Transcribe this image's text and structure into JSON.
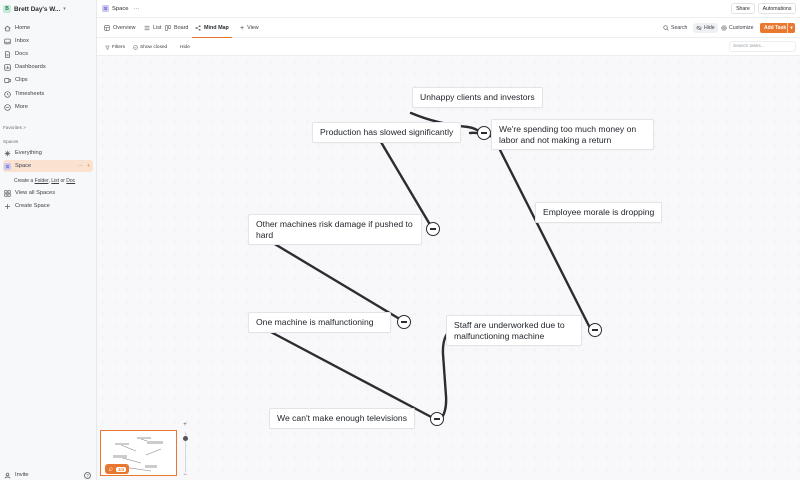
{
  "workspace": {
    "initial": "B",
    "name": "Brett Day's W...",
    "chevron_icon": "chevron-down-icon"
  },
  "sidebar": {
    "nav": [
      {
        "label": "Home",
        "icon": "home-icon"
      },
      {
        "label": "Inbox",
        "icon": "inbox-icon"
      },
      {
        "label": "Docs",
        "icon": "docs-icon"
      },
      {
        "label": "Dashboards",
        "icon": "dashboard-icon"
      },
      {
        "label": "Clips",
        "icon": "clips-icon"
      },
      {
        "label": "Timesheets",
        "icon": "timesheet-icon"
      },
      {
        "label": "More",
        "icon": "more-icon"
      }
    ],
    "favorites_label": "Favorites",
    "favorites_chevron": ">",
    "spaces_label": "Spaces",
    "everything_label": "Everything",
    "space": {
      "initial": "S",
      "label": "Space",
      "dots": "···",
      "plus": "+"
    },
    "create_prefix": "Create a",
    "create_folder": "Folder",
    "create_list": "List",
    "create_or": "or",
    "create_doc": "Doc",
    "view_all_spaces": "View all Spaces",
    "create_space": "Create Space",
    "invite_label": "Invite",
    "help": "?"
  },
  "topbar": {
    "space_initial": "S",
    "space_title": "Space",
    "dots": "···",
    "share_label": "Share",
    "automations_label": "Automations"
  },
  "views": {
    "tabs": [
      {
        "label": "Overview",
        "icon": "overview-icon"
      },
      {
        "label": "List",
        "icon": "list-icon"
      },
      {
        "label": "Board",
        "icon": "board-icon"
      },
      {
        "label": "Mind Map",
        "icon": "mindmap-icon",
        "active": true
      }
    ],
    "add_view_label": "View",
    "search_label": "Search",
    "hide_label": "Hide",
    "customize_label": "Customize",
    "add_task_label": "Add Task",
    "add_task_caret": "▾"
  },
  "filters": {
    "filters_label": "Filters",
    "show_closed_label": "Show closed",
    "hide_label": "Hide",
    "search_placeholder": "Search tasks..."
  },
  "mindmap": {
    "nodes": [
      {
        "id": "unhappy",
        "text": "Unhappy clients and investors"
      },
      {
        "id": "production",
        "text": "Production has slowed significantly"
      },
      {
        "id": "spending",
        "text": "We're spending too much money on labor and not making a return"
      },
      {
        "id": "morale",
        "text": "Employee morale is dropping"
      },
      {
        "id": "machines_risk",
        "text": "Other machines risk damage if pushed to hard"
      },
      {
        "id": "one_machine",
        "text": "One machine is malfunctioning"
      },
      {
        "id": "staff",
        "text": "Staff are underworked due to malfunctioning machine"
      },
      {
        "id": "televisions",
        "text": "We can't make enough televisions"
      }
    ],
    "links": [
      [
        "unhappy",
        "spending"
      ],
      [
        "production",
        "spending"
      ],
      [
        "machines_risk",
        "production"
      ],
      [
        "one_machine",
        "machines_risk"
      ],
      [
        "televisions",
        "one_machine"
      ],
      [
        "televisions",
        "staff"
      ],
      [
        "staff",
        "morale"
      ],
      [
        "morale",
        "spending"
      ]
    ]
  },
  "minimap": {
    "pill_icon": "rocket-icon",
    "pill_count": "1/4"
  },
  "zoom": {
    "in_label": "+",
    "out_label": "−"
  },
  "colors": {
    "accent": "#e8782f",
    "line": "#2b2d31"
  }
}
